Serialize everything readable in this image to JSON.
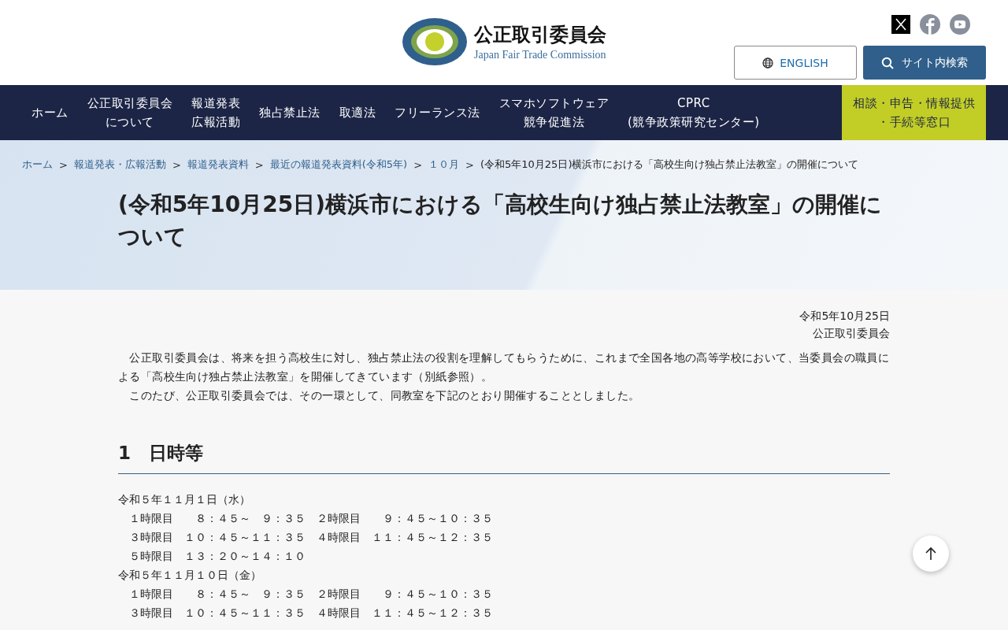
{
  "header": {
    "org_name": "公正取引委員会",
    "org_name_en": "Japan Fair Trade Commission",
    "english_button": "ENGLISH",
    "search_button": "サイト内検索"
  },
  "nav": [
    {
      "lines": [
        "ホーム"
      ],
      "kind": "normal"
    },
    {
      "lines": [
        "公正取引委員会",
        "について"
      ],
      "kind": "normal"
    },
    {
      "lines": [
        "報道発表",
        "広報活動"
      ],
      "kind": "normal"
    },
    {
      "lines": [
        "独占禁止法"
      ],
      "kind": "normal"
    },
    {
      "lines": [
        "取適法"
      ],
      "kind": "normal"
    },
    {
      "lines": [
        "フリーランス法"
      ],
      "kind": "normal"
    },
    {
      "lines": [
        "スマホソフトウェア",
        "競争促進法"
      ],
      "kind": "normal"
    },
    {
      "lines": [
        "CPRC",
        "(競争政策研究センター)"
      ],
      "kind": "normal"
    },
    {
      "lines": [
        "相談・申告・情報提供",
        "・手続等窓口"
      ],
      "kind": "highlight"
    }
  ],
  "breadcrumb": [
    {
      "label": "ホーム",
      "link": true
    },
    {
      "separator": ">",
      "label": "報道発表・広報活動",
      "link": true
    },
    {
      "separator": ">",
      "label": "報道発表資料",
      "link": true
    },
    {
      "separator": ">",
      "label": "最近の報道発表資料(令和5年)",
      "link": true
    },
    {
      "separator": ">",
      "label": "１０月",
      "link": true
    },
    {
      "separator": ">",
      "label": "(令和5年10月25日)横浜市における「高校生向け独占禁止法教室」の開催について",
      "link": false
    }
  ],
  "page_title": "(令和5年10月25日)横浜市における「高校生向け独占禁止法教室」の開催について",
  "date": "令和5年10月25日",
  "issuer": "公正取引委員会",
  "paragraphs": [
    "　公正取引委員会は、将来を担う高校生に対し、独占禁止法の役割を理解してもらうために、これまで全国各地の高等学校において、当委員会の職員による「高校生向け独占禁止法教室」を開催してきています（別紙参照）。",
    "　このたび、公正取引委員会では、その一環として、同教室を下記のとおり開催することとしました。"
  ],
  "section_heading": "1　日時等",
  "schedule": [
    "令和５年１１月１日（水）",
    "　１時限目　　８：４５～　９：３５　２時限目　　９：４５～１０：３５",
    "　３時限目　１０：４５～１１：３５　４時限目　１１：４５～１２：３５",
    "　５時限目　１３：２０～１４：１０",
    "令和５年１１月１０日（金）",
    "　１時限目　　８：４５～　９：３５　２時限目　　９：４５～１０：３５",
    "　３時限目　１０：４５～１１：３５　４時限目　１１：４５～１２：３５"
  ]
}
